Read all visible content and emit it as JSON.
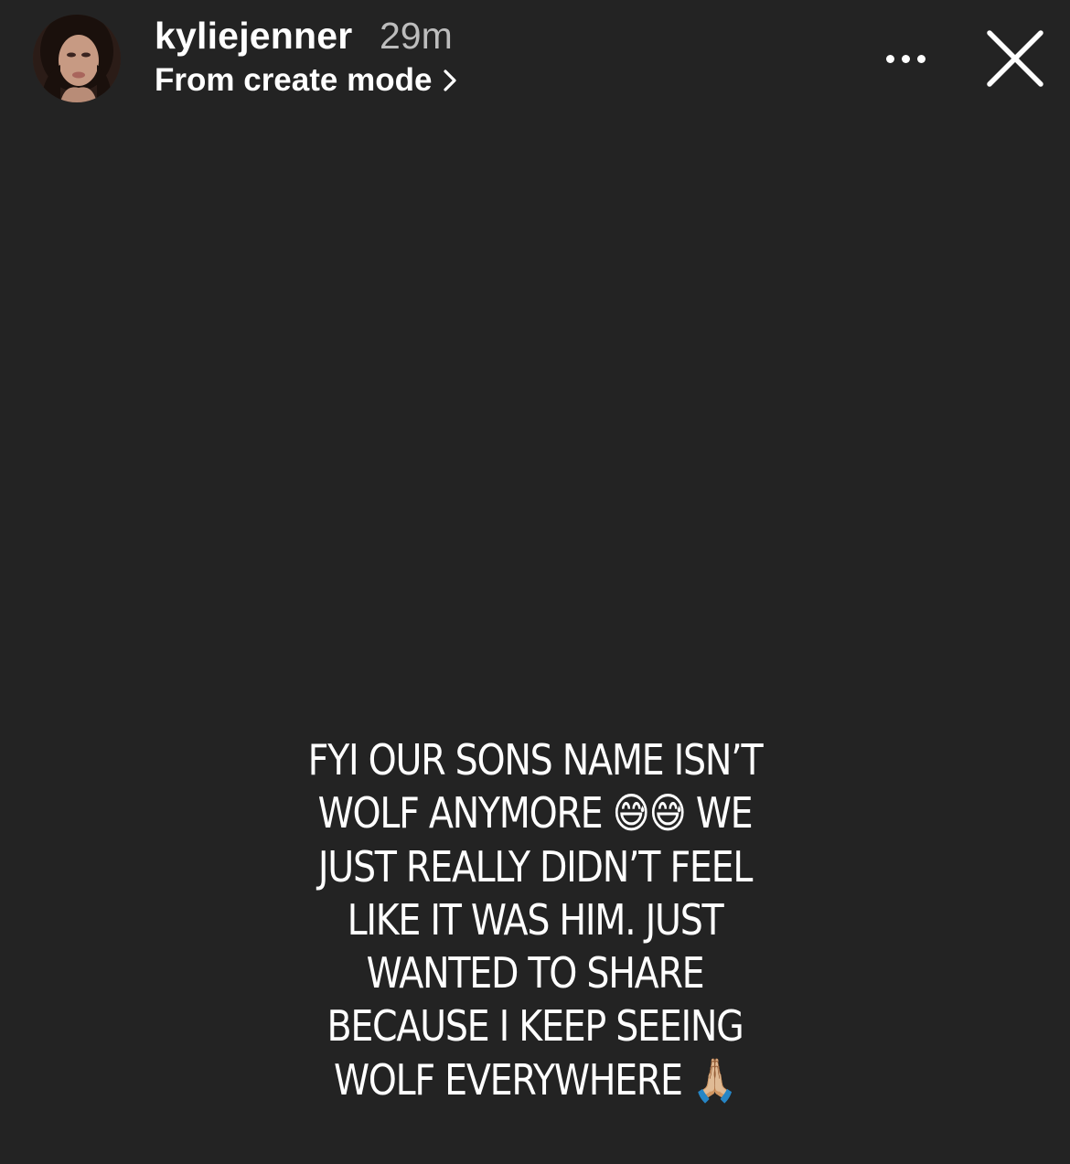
{
  "header": {
    "username": "kyliejenner",
    "timestamp": "29m",
    "create_mode_label": "From create mode",
    "more_label": "•••"
  },
  "caption": {
    "lines": [
      "FYI OUR SONS NAME ISN’T",
      "WOLF ANYMORE 😅😅 WE",
      "JUST REALLY DIDN’T FEEL",
      "LIKE IT WAS HIM. JUST",
      "WANTED TO SHARE",
      "BECAUSE I KEEP SEEING",
      "WOLF EVERYWHERE 🙏🏼"
    ]
  },
  "icons": {
    "more": "more-options-icon",
    "close": "close-icon",
    "chevron": "chevron-right-icon",
    "avatar": "profile-avatar"
  },
  "colors": {
    "background": "#232323",
    "text": "#ffffff",
    "timestamp": "#bdbdbd"
  }
}
